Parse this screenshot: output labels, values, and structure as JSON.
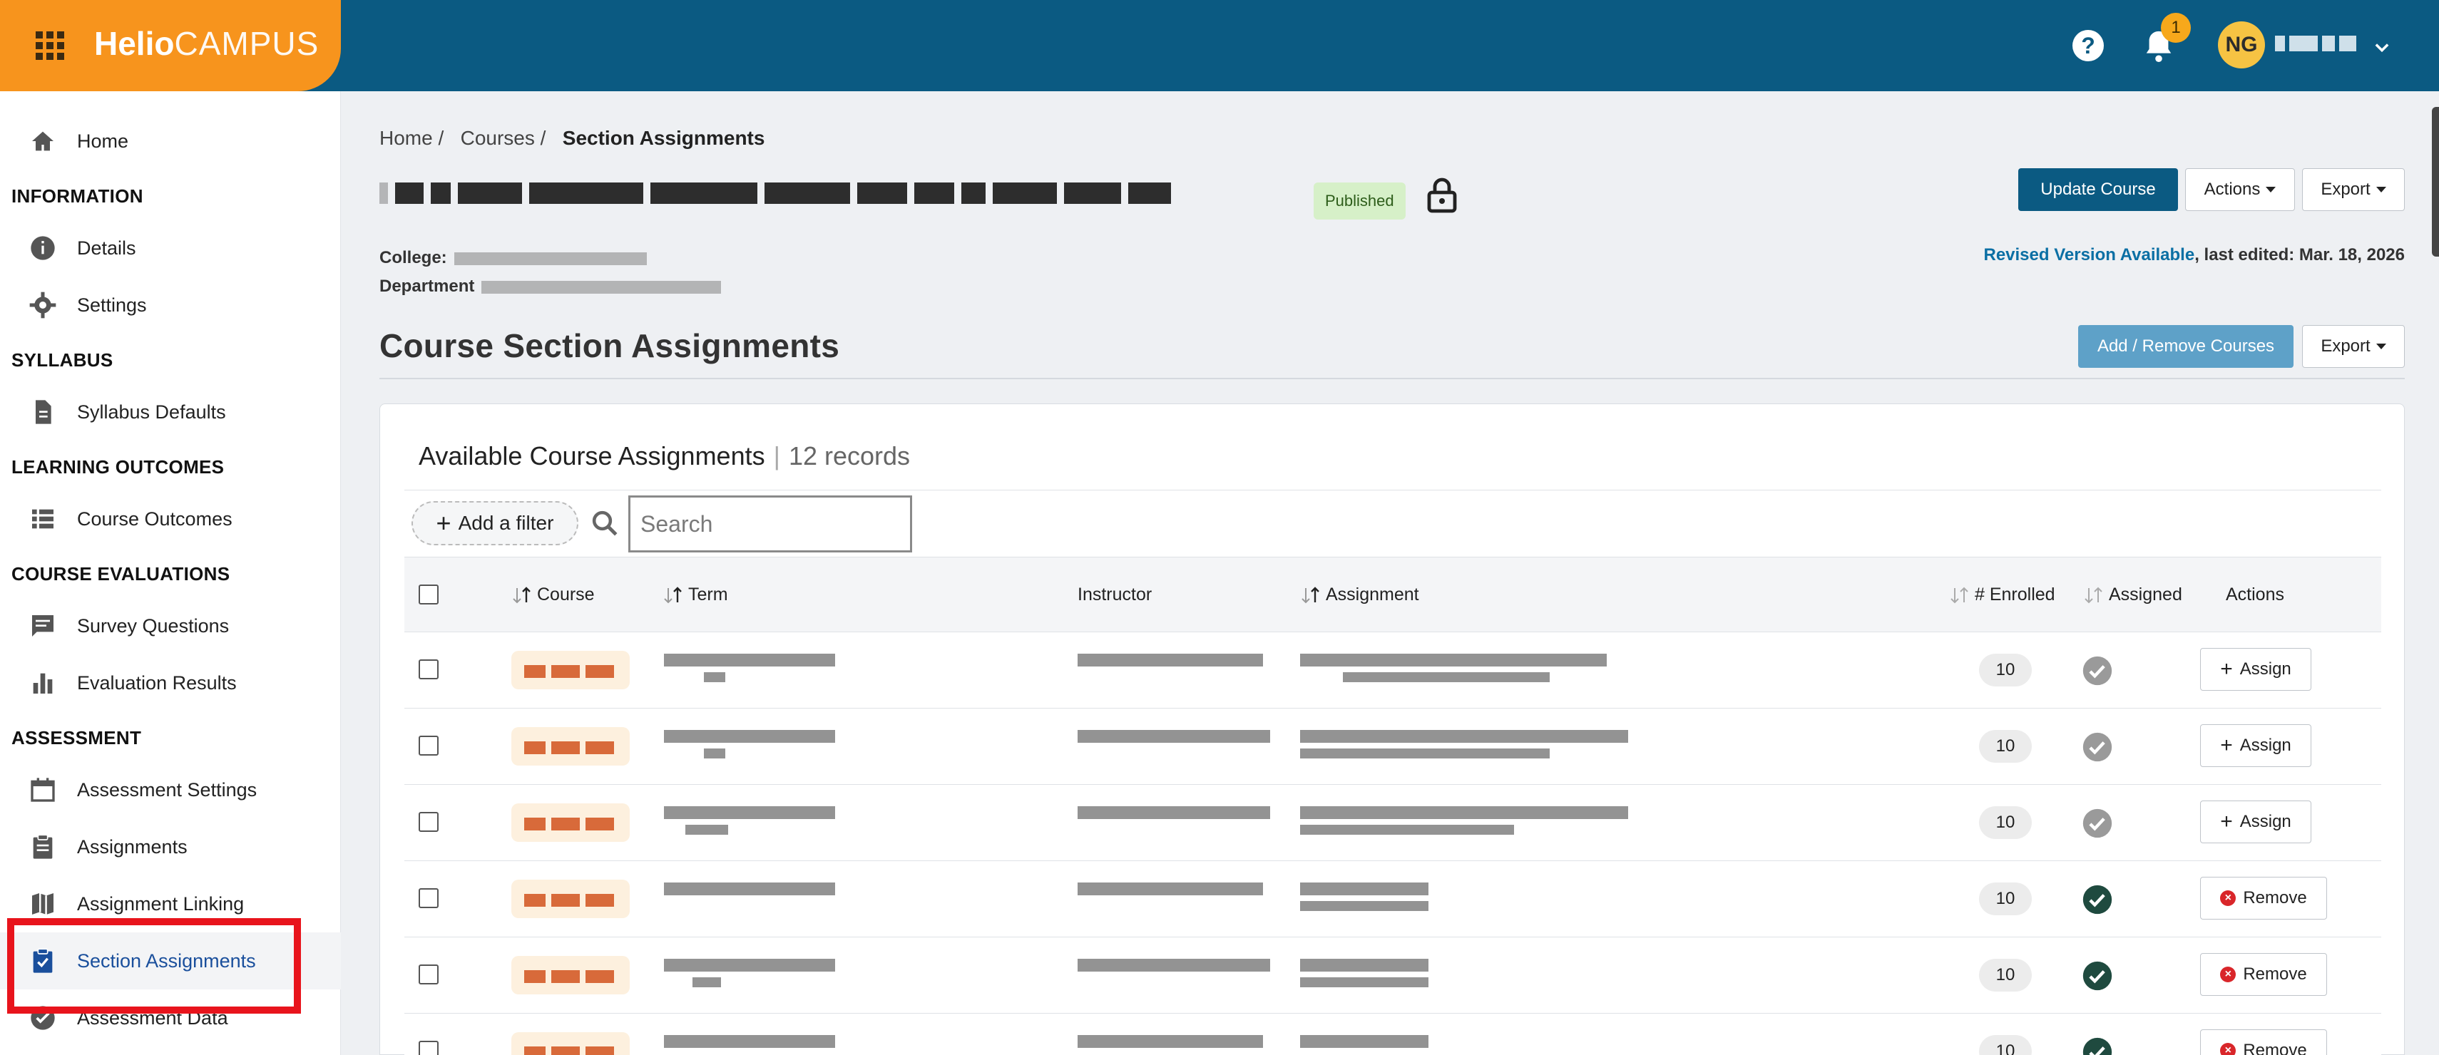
{
  "app": {
    "brand_bold": "Helio",
    "brand_light": "CAMPUS",
    "help_symbol": "?",
    "notification_count": "1",
    "user_initials": "NG"
  },
  "sidebar": {
    "items": [
      {
        "type": "link",
        "label": "Home",
        "icon": "home-icon"
      },
      {
        "type": "header",
        "label": "INFORMATION"
      },
      {
        "type": "link",
        "label": "Details",
        "icon": "info-icon"
      },
      {
        "type": "link",
        "label": "Settings",
        "icon": "gear-icon"
      },
      {
        "type": "header",
        "label": "SYLLABUS"
      },
      {
        "type": "link",
        "label": "Syllabus Defaults",
        "icon": "document-icon"
      },
      {
        "type": "header",
        "label": "LEARNING OUTCOMES"
      },
      {
        "type": "link",
        "label": "Course Outcomes",
        "icon": "list-icon"
      },
      {
        "type": "header",
        "label": "COURSE EVALUATIONS"
      },
      {
        "type": "link",
        "label": "Survey Questions",
        "icon": "comment-icon"
      },
      {
        "type": "link",
        "label": "Evaluation Results",
        "icon": "bar-chart-icon"
      },
      {
        "type": "header",
        "label": "ASSESSMENT"
      },
      {
        "type": "link",
        "label": "Assessment Settings",
        "icon": "calendar-icon"
      },
      {
        "type": "link",
        "label": "Assignments",
        "icon": "clipboard-icon"
      },
      {
        "type": "link",
        "label": "Assignment Linking",
        "icon": "map-icon"
      },
      {
        "type": "link",
        "label": "Section Assignments",
        "icon": "clipboard-check-icon",
        "active": true
      },
      {
        "type": "link",
        "label": "Assessment Data",
        "icon": "check-circle-icon"
      }
    ]
  },
  "breadcrumb": {
    "home": "Home /",
    "courses": "Courses /",
    "current": "Section Assignments"
  },
  "course": {
    "status": "Published",
    "college_label": "College:",
    "department_label": "Department"
  },
  "toolbar": {
    "update_label": "Update Course",
    "actions_label": "Actions",
    "export_label": "Export",
    "revised_link": "Revised Version Available",
    "last_edited": ", last edited: Mar. 18, 2026"
  },
  "section": {
    "title": "Course Section Assignments",
    "add_remove_label": "Add / Remove Courses",
    "export_label": "Export"
  },
  "table_card": {
    "title": "Available Course Assignments",
    "separator": "|",
    "record_count": "12 records",
    "filter_label": "Add a filter",
    "search_placeholder": "Search",
    "columns": [
      "Course",
      "Term",
      "Instructor",
      "Assignment",
      "# Enrolled",
      "Assigned",
      "Actions"
    ],
    "rows": [
      {
        "enrolled": "10",
        "assigned": false,
        "action": "Assign"
      },
      {
        "enrolled": "10",
        "assigned": false,
        "action": "Assign"
      },
      {
        "enrolled": "10",
        "assigned": false,
        "action": "Assign"
      },
      {
        "enrolled": "10",
        "assigned": true,
        "action": "Remove"
      },
      {
        "enrolled": "10",
        "assigned": true,
        "action": "Remove"
      },
      {
        "enrolled": "10",
        "assigned": true,
        "action": "Remove"
      }
    ]
  },
  "colors": {
    "topbar": "#0b5a82",
    "brand": "#f7941d",
    "assigned_check": "#1f4a3f",
    "unassigned_check": "#9a9a9a",
    "remove_icon": "#d9262a",
    "highlight_box": "#e8141c"
  }
}
